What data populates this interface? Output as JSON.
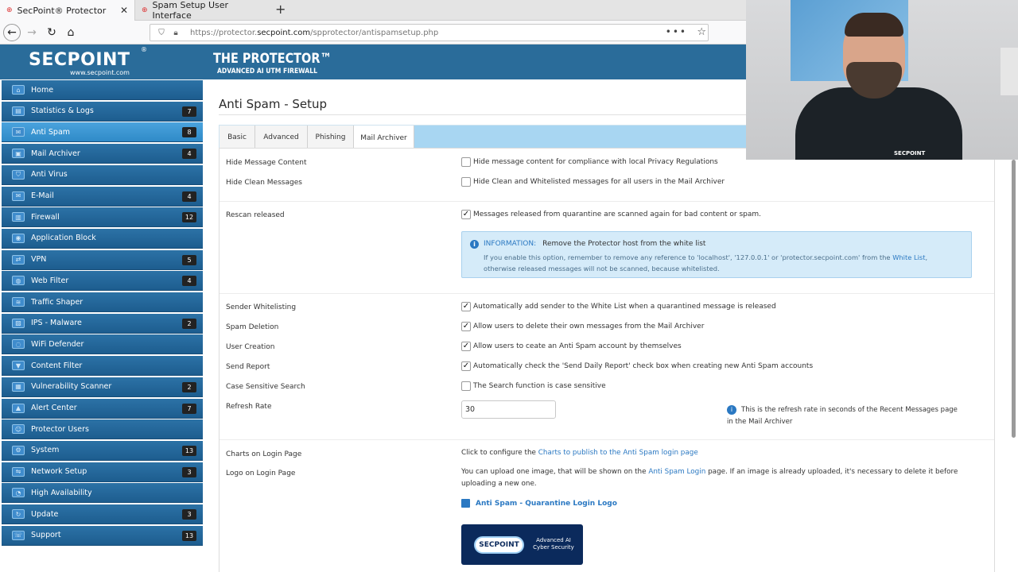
{
  "browser": {
    "tabs": [
      {
        "title": "SecPoint® Protector",
        "active": true
      },
      {
        "title": "Spam Setup User Interface",
        "active": false
      }
    ],
    "url_prefix": "https://protector.",
    "url_domain": "secpoint.com",
    "url_path": "/spprotector/antispamsetup.php"
  },
  "header": {
    "logo": "SECPOINT",
    "logo_sub": "www.secpoint.com",
    "logo_reg": "®",
    "product": "THE PROTECTOR™",
    "product_sub": "ADVANCED AI UTM FIREWALL"
  },
  "sidebar": {
    "items": [
      {
        "label": "Home",
        "badge": "",
        "icon": "home-icon"
      },
      {
        "label": "Statistics & Logs",
        "badge": "7",
        "icon": "chart-icon"
      },
      {
        "label": "Anti Spam",
        "badge": "8",
        "icon": "mail-icon"
      },
      {
        "label": "Mail Archiver",
        "badge": "4",
        "icon": "archive-icon"
      },
      {
        "label": "Anti Virus",
        "badge": "",
        "icon": "shield-icon"
      },
      {
        "label": "E-Mail",
        "badge": "4",
        "icon": "email-icon"
      },
      {
        "label": "Firewall",
        "badge": "12",
        "icon": "firewall-icon"
      },
      {
        "label": "Application Block",
        "badge": "",
        "icon": "block-icon"
      },
      {
        "label": "VPN",
        "badge": "5",
        "icon": "vpn-icon"
      },
      {
        "label": "Web Filter",
        "badge": "4",
        "icon": "globe-icon"
      },
      {
        "label": "Traffic Shaper",
        "badge": "",
        "icon": "traffic-icon"
      },
      {
        "label": "IPS - Malware",
        "badge": "2",
        "icon": "ips-icon"
      },
      {
        "label": "WiFi Defender",
        "badge": "",
        "icon": "wifi-icon"
      },
      {
        "label": "Content Filter",
        "badge": "",
        "icon": "filter-icon"
      },
      {
        "label": "Vulnerability Scanner",
        "badge": "2",
        "icon": "scanner-icon"
      },
      {
        "label": "Alert Center",
        "badge": "7",
        "icon": "alert-icon"
      },
      {
        "label": "Protector Users",
        "badge": "",
        "icon": "users-icon"
      },
      {
        "label": "System",
        "badge": "13",
        "icon": "gear-icon"
      },
      {
        "label": "Network Setup",
        "badge": "3",
        "icon": "network-icon"
      },
      {
        "label": "High Availability",
        "badge": "",
        "icon": "availability-icon"
      },
      {
        "label": "Update",
        "badge": "3",
        "icon": "update-icon"
      },
      {
        "label": "Support",
        "badge": "13",
        "icon": "support-icon"
      }
    ],
    "active_index": 2
  },
  "main": {
    "title": "Anti Spam - Setup",
    "tabs": [
      "Basic",
      "Advanced",
      "Phishing",
      "Mail Archiver"
    ],
    "active_tab": 3,
    "rows": {
      "hide_content": {
        "label": "Hide Message Content",
        "text": "Hide message content for compliance with local Privacy Regulations",
        "checked": false
      },
      "hide_clean": {
        "label": "Hide Clean Messages",
        "text": "Hide Clean and Whitelisted messages for all users in the Mail Archiver",
        "checked": false
      },
      "rescan": {
        "label": "Rescan released",
        "text": "Messages released from quarantine are scanned again for bad content or spam.",
        "checked": true
      },
      "sender_whitelisting": {
        "label": "Sender Whitelisting",
        "text": "Automatically add sender to the White List when a quarantined message is released",
        "checked": true
      },
      "spam_deletion": {
        "label": "Spam Deletion",
        "text": "Allow users to delete their own messages from the Mail Archiver",
        "checked": true
      },
      "user_creation": {
        "label": "User Creation",
        "text": "Allow users to ceate an Anti Spam account by themselves",
        "checked": true
      },
      "send_report": {
        "label": "Send Report",
        "text": "Automatically check the 'Send Daily Report' check box when creating new Anti Spam accounts",
        "checked": true
      },
      "case_sensitive": {
        "label": "Case Sensitive Search",
        "text": "The Search function is case sensitive",
        "checked": false
      },
      "refresh_rate": {
        "label": "Refresh Rate",
        "value": "30",
        "hint": "This is the refresh rate in seconds of the Recent Messages page in the Mail Archiver"
      },
      "charts": {
        "label": "Charts on Login Page",
        "text_before": "Click to configure the ",
        "link": "Charts to publish to the Anti Spam login page"
      },
      "logo": {
        "label": "Logo on Login Page",
        "text_before": "You can upload one image, that will be shown on the ",
        "link": "Anti Spam Login",
        "text_after": " page. If an image is already uploaded, it's necessary to delete it before uploading a new one.",
        "file_link": "Anti Spam - Quarantine Login Logo"
      }
    },
    "info": {
      "label": "INFORMATION:",
      "heading": "Remove the Protector host from the white list",
      "text_before": "If you enable this option, remember to remove any reference to 'localhost', '127.0.0.1' or 'protector.secpoint.com' from the ",
      "link": "White List",
      "text_after": ", otherwise released messages will not be scanned, because whitelisted."
    },
    "login_logo_image": {
      "brand": "SECPOINT",
      "caption": "Advanced AI Cyber Security"
    }
  },
  "webcam": {
    "shirt_text": "SECPOINT"
  },
  "colors": {
    "brand_blue": "#2a6c9a",
    "sidebar_active": "#3a98d6",
    "link": "#2a78c2",
    "info_bg": "#d5ebf9"
  }
}
